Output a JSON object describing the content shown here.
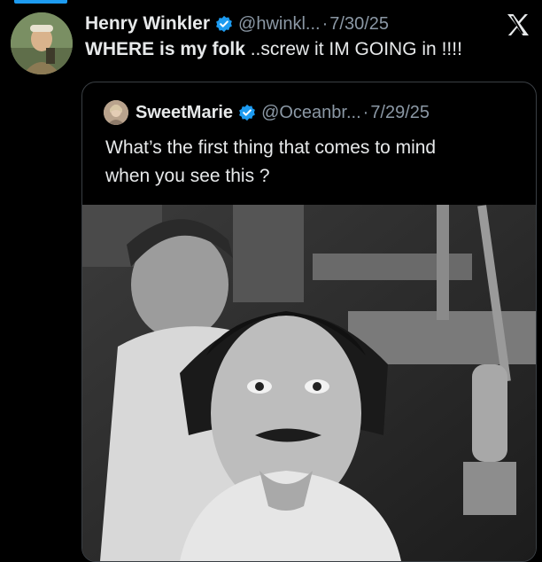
{
  "tweet": {
    "author_name": "Henry Winkler",
    "handle": "@hwinkl...",
    "separator": "·",
    "date": "7/30/25",
    "text_bold": "WHERE is my folk",
    "text_rest": " ..screw it IM GOING in !!!!"
  },
  "quote": {
    "author_name": "SweetMarie",
    "handle": "@Oceanbr...",
    "separator": "·",
    "date": "7/29/25",
    "text_line1": "What’s the first thing that comes to mind",
    "text_line2": "when you see this ?"
  },
  "icons": {
    "verified": "verified-badge-icon",
    "platform": "x-logo-icon"
  },
  "colors": {
    "background": "#000000",
    "primary_text": "#e7e9ea",
    "secondary_text": "#8b98a5",
    "verified_blue": "#1d9bf0",
    "card_border": "#3a3f44"
  }
}
